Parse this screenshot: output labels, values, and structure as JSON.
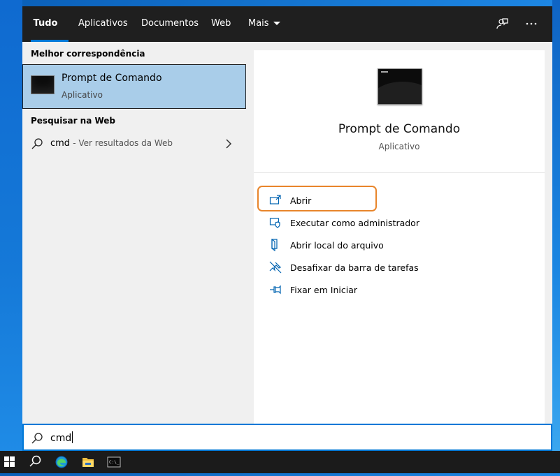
{
  "tabs": [
    {
      "label": "Tudo",
      "active": true
    },
    {
      "label": "Aplicativos",
      "active": false
    },
    {
      "label": "Documentos",
      "active": false
    },
    {
      "label": "Web",
      "active": false
    },
    {
      "label": "Mais",
      "active": false
    }
  ],
  "topbar_icons": [
    "feedback-icon",
    "more-options-icon"
  ],
  "left": {
    "best_match_heading": "Melhor correspondência",
    "best_match": {
      "title": "Prompt de Comando",
      "subtitle": "Aplicativo"
    },
    "web_heading": "Pesquisar na Web",
    "web_item": {
      "term": "cmd",
      "hint": "- Ver resultados da Web"
    }
  },
  "detail": {
    "title": "Prompt de Comando",
    "subtitle": "Aplicativo",
    "actions": [
      {
        "label": "Abrir",
        "icon": "open-icon"
      },
      {
        "label": "Executar como administrador",
        "icon": "shield-icon"
      },
      {
        "label": "Abrir local do arquivo",
        "icon": "file-location-icon"
      },
      {
        "label": "Desafixar da barra de tarefas",
        "icon": "unpin-icon"
      },
      {
        "label": "Fixar em Iniciar",
        "icon": "pin-icon"
      }
    ]
  },
  "search": {
    "query": "cmd"
  },
  "taskbar": [
    "windows-start-icon",
    "search-icon",
    "edge-icon",
    "file-explorer-icon",
    "command-prompt-icon"
  ],
  "colors": {
    "accent": "#0078d7",
    "selection": "#a9cde9",
    "highlight_outline": "#e8852b",
    "topbar": "#1f1f1f"
  }
}
